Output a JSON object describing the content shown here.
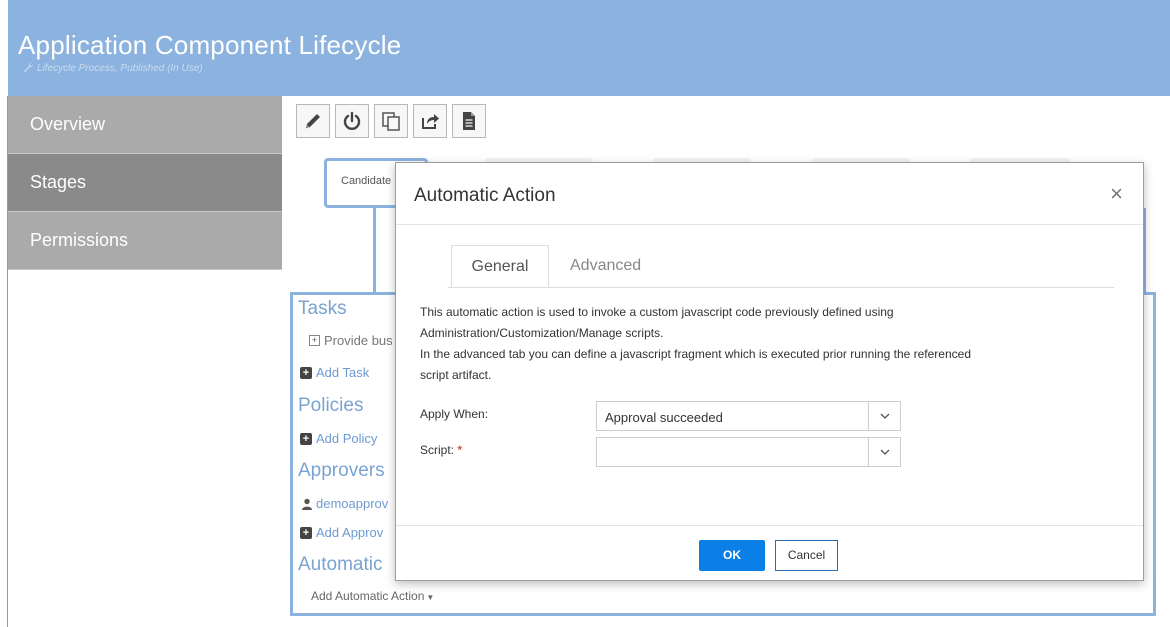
{
  "header": {
    "title": "Application Component Lifecycle",
    "subtitle": "Lifecycle Process, Published (In Use)",
    "subtitle_icon": "wrench-icon"
  },
  "sidebar": {
    "items": [
      {
        "label": "Overview",
        "active": false
      },
      {
        "label": "Stages",
        "active": true
      },
      {
        "label": "Permissions",
        "active": false
      }
    ]
  },
  "toolbar": {
    "icons": [
      "pencil-icon",
      "power-icon",
      "copy-icon",
      "share-icon",
      "document-icon"
    ]
  },
  "stage": {
    "active_tab_label": "Candidate"
  },
  "detail": {
    "tasks_heading": "Tasks",
    "task_item": "Provide bus",
    "add_task": "Add Task",
    "policies_heading": "Policies",
    "add_policy": "Add Policy",
    "approvers_heading": "Approvers",
    "approver_user": "demoapprov",
    "add_approver": "Add Approv",
    "automatic_heading": "Automatic",
    "add_automatic_action": "Add Automatic Action"
  },
  "modal": {
    "title": "Automatic Action",
    "close_glyph": "×",
    "tabs": [
      {
        "label": "General",
        "active": true
      },
      {
        "label": "Advanced",
        "active": false
      }
    ],
    "description_lines": [
      "This automatic action is used to invoke a custom javascript code previously defined using",
      "Administration/Customization/Manage scripts.",
      "In the advanced tab you can define a javascript fragment which is executed prior running the referenced",
      "script artifact."
    ],
    "apply_when_label": "Apply When:",
    "apply_when_value": "Approval succeeded",
    "script_label": "Script:",
    "script_required": "*",
    "script_value": "",
    "ok_label": "OK",
    "cancel_label": "Cancel"
  },
  "colors": {
    "header_bg": "#8cb3df",
    "sidebar_bg": "#aaaaaa",
    "sidebar_active_bg": "#8a8a8a",
    "primary_button": "#0a7fe6",
    "link": "#6d9bd1"
  }
}
